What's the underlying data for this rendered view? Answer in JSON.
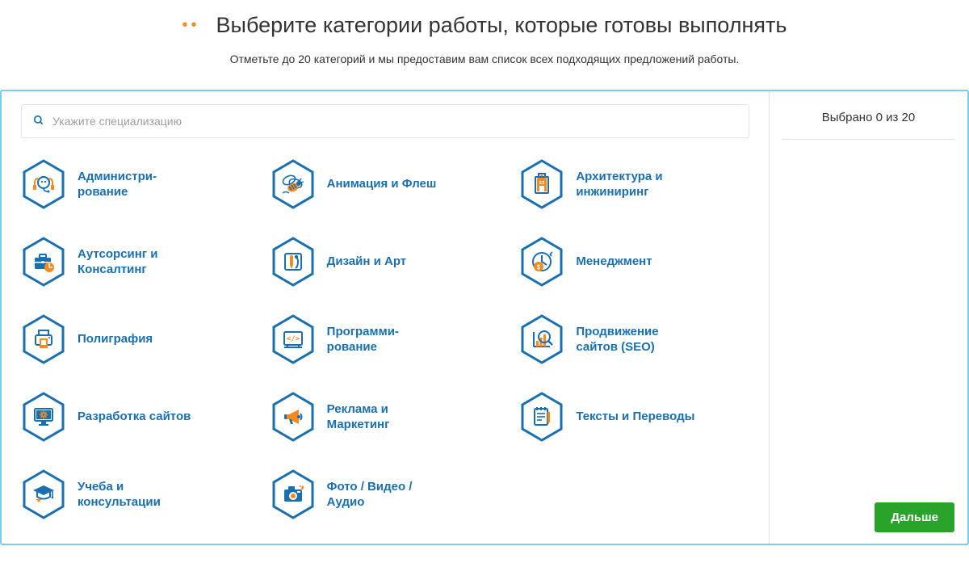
{
  "heading": "Выберите категории работы, которые готовы выполнять",
  "subtitle": "Отметьте до 20 категорий и мы предоставим вам список всех подходящих предложений работы.",
  "search": {
    "placeholder": "Укажите специализацию"
  },
  "selection_counter": "Выбрано 0 из 20",
  "next_label": "Дальше",
  "colors": {
    "accent_blue": "#1a6fb0",
    "accent_orange": "#f58a1f",
    "panel_border": "#7ecaf2",
    "green": "#29a329"
  },
  "categories": [
    {
      "icon": "headset",
      "label": "Администри-\nрование"
    },
    {
      "icon": "bee",
      "label": "Анимация и Флеш"
    },
    {
      "icon": "building",
      "label": "Архитектура и инжиниринг"
    },
    {
      "icon": "briefcase",
      "label": "Аутсорсинг и Консалтинг"
    },
    {
      "icon": "paint",
      "label": "Дизайн и Арт"
    },
    {
      "icon": "clock-dollar",
      "label": "Менеджмент"
    },
    {
      "icon": "printer",
      "label": "Полиграфия"
    },
    {
      "icon": "code",
      "label": "Программи-\nрование"
    },
    {
      "icon": "seo",
      "label": "Продвижение сайтов (SEO)"
    },
    {
      "icon": "monitor-gear",
      "label": "Разработка сайтов"
    },
    {
      "icon": "megaphone",
      "label": "Реклама и Маркетинг"
    },
    {
      "icon": "notepad",
      "label": "Тексты и Переводы"
    },
    {
      "icon": "gradcap",
      "label": "Учеба и консультации"
    },
    {
      "icon": "camera",
      "label": "Фото / Видео / Аудио"
    }
  ]
}
